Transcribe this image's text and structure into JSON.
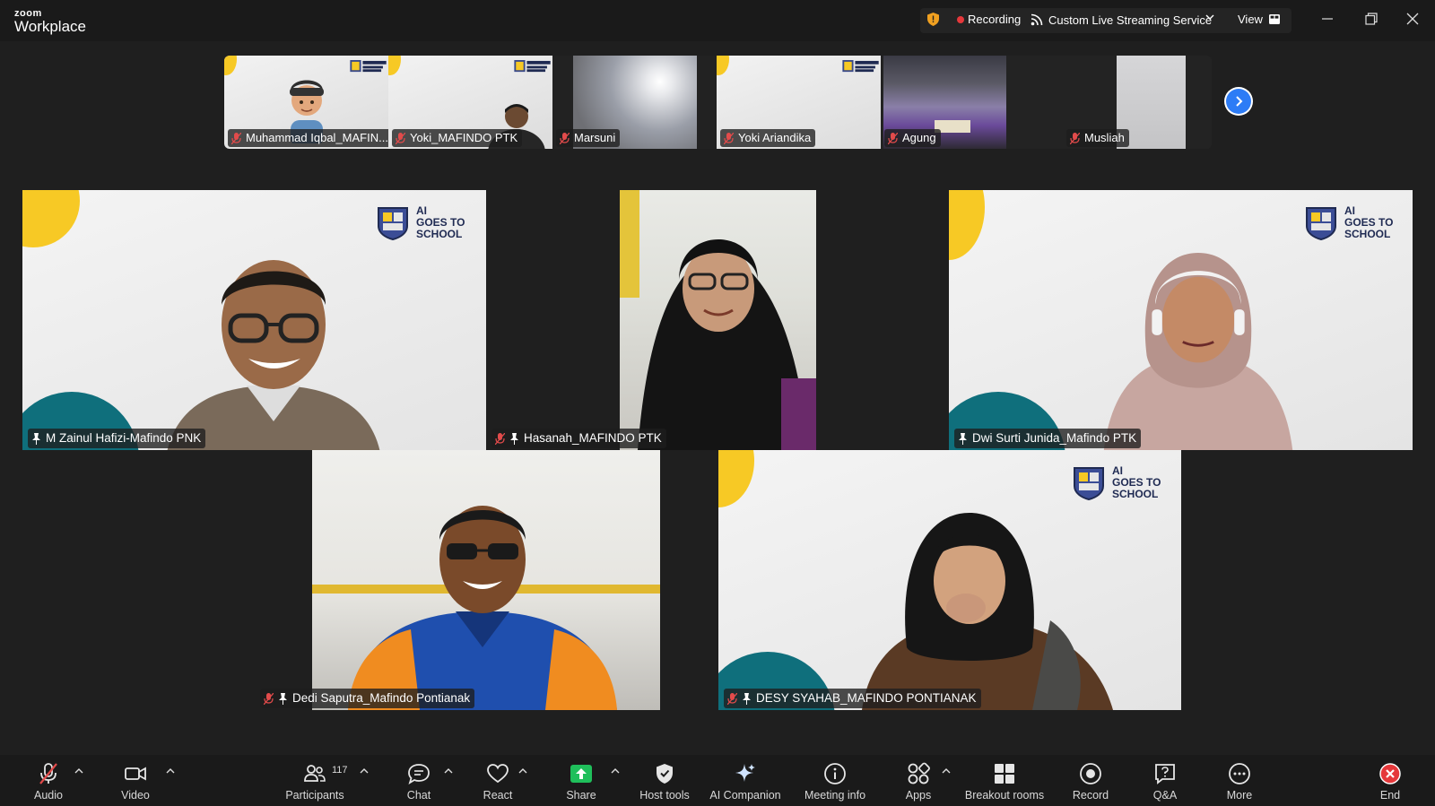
{
  "app": {
    "brand_small": "zoom",
    "brand_name": "Workplace",
    "recording_label": "Recording",
    "stream_label": "Custom Live Streaming Service",
    "view_label": "View"
  },
  "filmstrip": {
    "participants": [
      {
        "name": "Muhammad Iqbal_MAFIN..."
      },
      {
        "name": "Yoki_MAFINDO PTK"
      },
      {
        "name": "Marsuni"
      },
      {
        "name": "Yoki Ariandika"
      },
      {
        "name": "Agung"
      },
      {
        "name": "Musliah"
      }
    ]
  },
  "slide_badge": {
    "line1": "AI",
    "line2": "GOES TO",
    "line3": "SCHOOL"
  },
  "tiles": [
    {
      "name": "M Zainul Hafizi-Mafindo PNK"
    },
    {
      "name": "Hasanah_MAFINDO PTK"
    },
    {
      "name": "Dwi Surti Junida_Mafindo PTK"
    },
    {
      "name": "Dedi Saputra_Mafindo Pontianak"
    },
    {
      "name": "DESY SYAHAB_MAFINDO PONTIANAK"
    }
  ],
  "toolbar": {
    "audio": "Audio",
    "video": "Video",
    "participants": "Participants",
    "participants_count": "117",
    "chat": "Chat",
    "react": "React",
    "share": "Share",
    "host_tools": "Host tools",
    "ai_companion": "AI Companion",
    "meeting_info": "Meeting info",
    "apps": "Apps",
    "breakout_rooms": "Breakout rooms",
    "record": "Record",
    "qa": "Q&A",
    "more": "More",
    "end": "End"
  },
  "colors": {
    "accent_blue": "#2d7cf6",
    "record_red": "#e5383b",
    "share_green": "#1fbf5b",
    "slide_yellow": "#f7c925",
    "slide_teal": "#0f6f7c"
  }
}
